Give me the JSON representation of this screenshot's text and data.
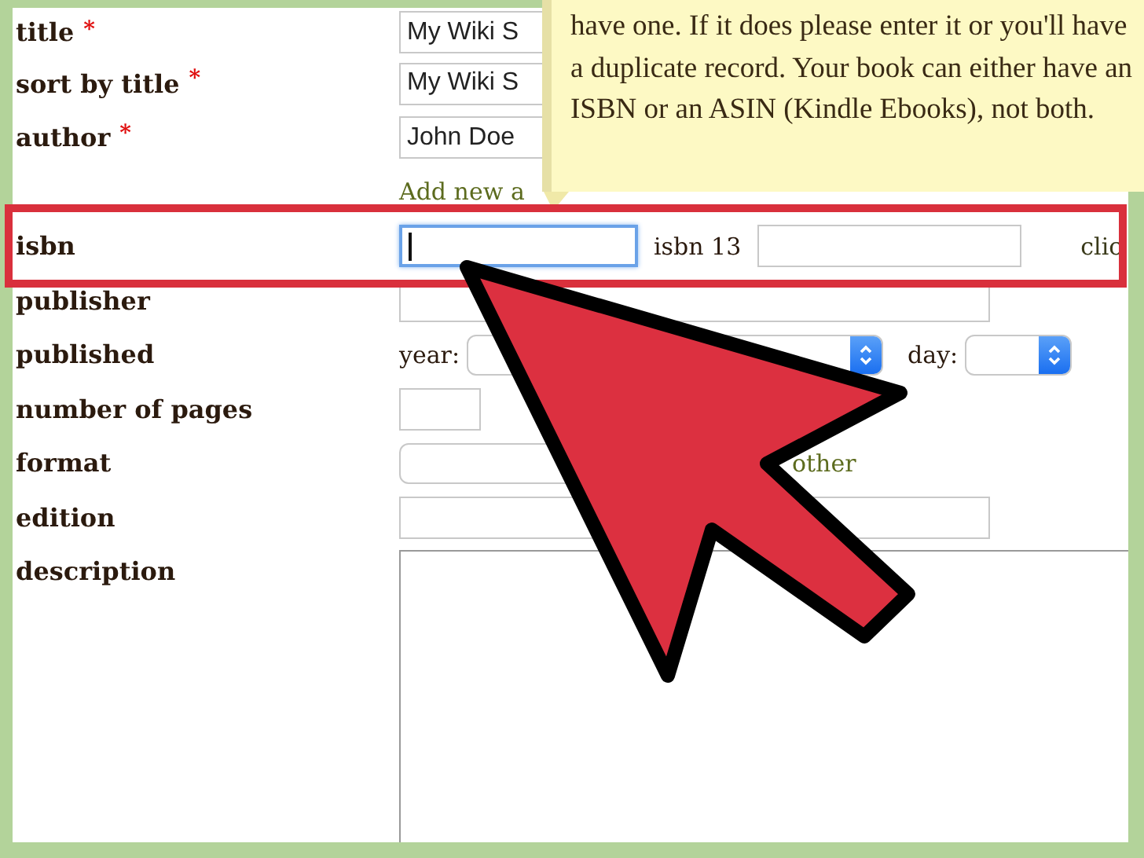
{
  "form": {
    "rows": [
      {
        "kind": "text",
        "label": "title",
        "required_mark": "*",
        "value": "My Wiki S"
      },
      {
        "kind": "text",
        "label": "sort by title",
        "required_mark": "*",
        "value": "My Wiki S"
      },
      {
        "kind": "text",
        "label": "author",
        "required_mark": "*",
        "value": "John Doe"
      },
      {
        "kind": "link",
        "link": "Add new a"
      },
      {
        "kind": "isbn",
        "label": "isbn",
        "focused": true,
        "second_label": "isbn 13",
        "link": "clic"
      },
      {
        "kind": "text",
        "label": "publisher"
      },
      {
        "kind": "date",
        "label": "published",
        "parts": [
          "year:",
          "day:"
        ]
      },
      {
        "kind": "short",
        "label": "number of pages"
      },
      {
        "kind": "select",
        "label": "format",
        "link": "other"
      },
      {
        "kind": "text",
        "label": "edition"
      },
      {
        "kind": "textarea",
        "label": "description"
      }
    ]
  },
  "tooltip": {
    "text": "have one. If it does please enter it or you'll have a duplicate record. Your book can either have an ISBN or an ASIN (Kindle Ebooks), not both."
  }
}
